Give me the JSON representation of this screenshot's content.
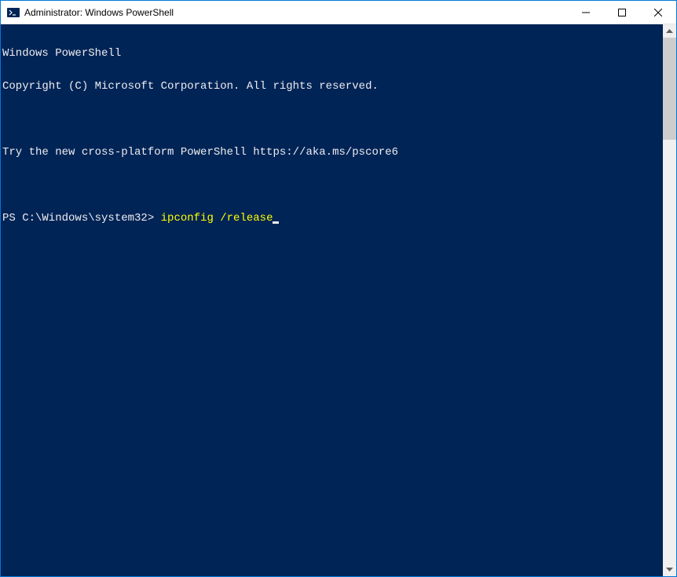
{
  "window": {
    "title": "Administrator: Windows PowerShell"
  },
  "terminal": {
    "line1": "Windows PowerShell",
    "line2": "Copyright (C) Microsoft Corporation. All rights reserved.",
    "line3": "",
    "line4": "Try the new cross-platform PowerShell https://aka.ms/pscore6",
    "line5": "",
    "prompt": "PS C:\\Windows\\system32> ",
    "command": "ipconfig /release"
  }
}
